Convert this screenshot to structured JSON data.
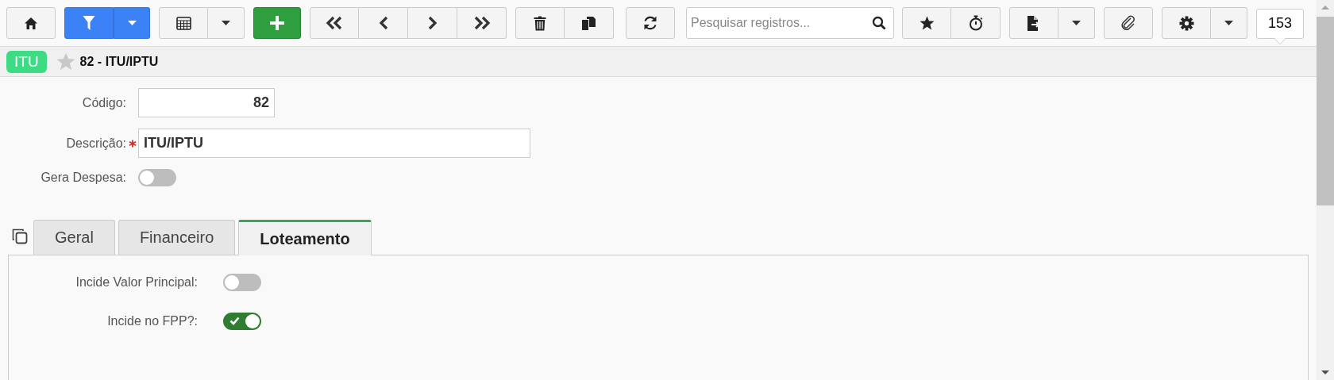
{
  "toolbar": {
    "search": {
      "placeholder": "Pesquisar registros..."
    },
    "record_count": "153"
  },
  "header": {
    "badge": "ITU",
    "favorite": false,
    "title": "82 - ITU/IPTU"
  },
  "form": {
    "fields": [
      {
        "kind": "number",
        "label": "Código:",
        "value": "82",
        "required": false
      },
      {
        "kind": "text",
        "label": "Descrição:",
        "value": "ITU/IPTU",
        "required": true
      },
      {
        "kind": "toggle",
        "label": "Gera Despesa:",
        "on": false
      }
    ]
  },
  "tabs": [
    {
      "label": "Geral",
      "selected": false
    },
    {
      "label": "Financeiro",
      "selected": false
    },
    {
      "label": "Loteamento",
      "selected": true
    }
  ],
  "tab_panel": {
    "fields": [
      {
        "kind": "toggle",
        "label": "Incide Valor Principal:",
        "on": false
      },
      {
        "kind": "toggle",
        "label": "Incide no FPP?:",
        "on": true
      }
    ]
  }
}
